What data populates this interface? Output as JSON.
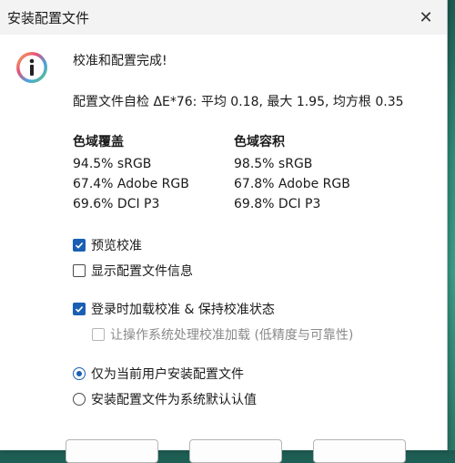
{
  "window": {
    "title": "安装配置文件",
    "close_glyph": "✕"
  },
  "dialog": {
    "headline": "校准和配置完成!",
    "check_summary": "配置文件自检 ΔE*76: 平均 0.18, 最大 1.95, 均方根 0.35",
    "gamut_coverage": {
      "heading": "色域覆盖",
      "rows": [
        "94.5% sRGB",
        "67.4% Adobe RGB",
        "69.6% DCI P3"
      ]
    },
    "gamut_volume": {
      "heading": "色域容积",
      "rows": [
        "98.5% sRGB",
        "67.8% Adobe RGB",
        "69.8% DCI P3"
      ]
    },
    "options": {
      "preview_calibration": {
        "label": "预览校准",
        "checked": true
      },
      "show_profile_info": {
        "label": "显示配置文件信息",
        "checked": false
      },
      "load_on_login": {
        "label": "登录时加载校准 & 保持校准状态",
        "checked": true
      },
      "let_os_handle": {
        "label": "让操作系统处理校准加载 (低精度与可靠性)",
        "checked": false,
        "disabled": true
      }
    },
    "install_scope": {
      "current_user": {
        "label": "仅为当前用户安装配置文件",
        "selected": true
      },
      "system_default": {
        "label": "安装配置文件为系统默认认值",
        "selected": false
      }
    }
  },
  "colors": {
    "accent": "#1a5fb4",
    "titlebar": "#f3f3f3"
  }
}
